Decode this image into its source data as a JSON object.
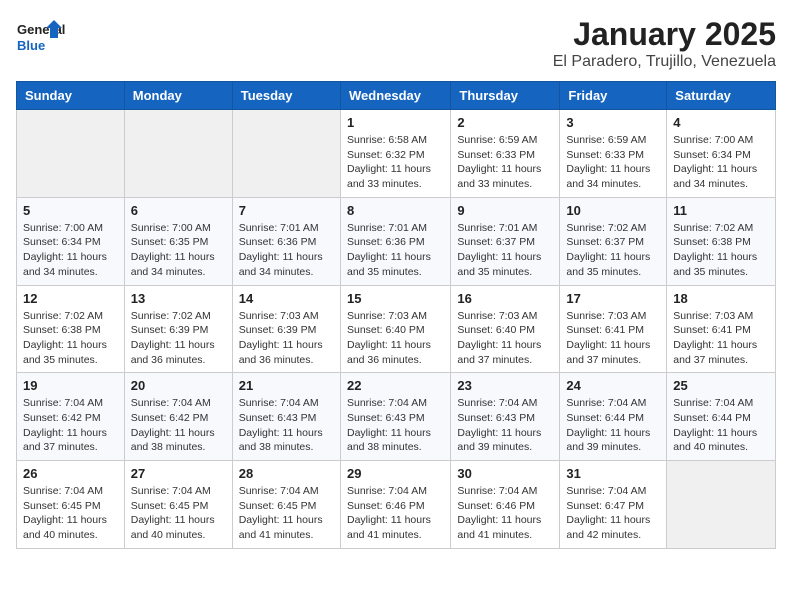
{
  "logo": {
    "line1": "General",
    "line2": "Blue"
  },
  "title": "January 2025",
  "subtitle": "El Paradero, Trujillo, Venezuela",
  "weekdays": [
    "Sunday",
    "Monday",
    "Tuesday",
    "Wednesday",
    "Thursday",
    "Friday",
    "Saturday"
  ],
  "weeks": [
    [
      {
        "day": "",
        "info": ""
      },
      {
        "day": "",
        "info": ""
      },
      {
        "day": "",
        "info": ""
      },
      {
        "day": "1",
        "info": "Sunrise: 6:58 AM\nSunset: 6:32 PM\nDaylight: 11 hours\nand 33 minutes."
      },
      {
        "day": "2",
        "info": "Sunrise: 6:59 AM\nSunset: 6:33 PM\nDaylight: 11 hours\nand 33 minutes."
      },
      {
        "day": "3",
        "info": "Sunrise: 6:59 AM\nSunset: 6:33 PM\nDaylight: 11 hours\nand 34 minutes."
      },
      {
        "day": "4",
        "info": "Sunrise: 7:00 AM\nSunset: 6:34 PM\nDaylight: 11 hours\nand 34 minutes."
      }
    ],
    [
      {
        "day": "5",
        "info": "Sunrise: 7:00 AM\nSunset: 6:34 PM\nDaylight: 11 hours\nand 34 minutes."
      },
      {
        "day": "6",
        "info": "Sunrise: 7:00 AM\nSunset: 6:35 PM\nDaylight: 11 hours\nand 34 minutes."
      },
      {
        "day": "7",
        "info": "Sunrise: 7:01 AM\nSunset: 6:36 PM\nDaylight: 11 hours\nand 34 minutes."
      },
      {
        "day": "8",
        "info": "Sunrise: 7:01 AM\nSunset: 6:36 PM\nDaylight: 11 hours\nand 35 minutes."
      },
      {
        "day": "9",
        "info": "Sunrise: 7:01 AM\nSunset: 6:37 PM\nDaylight: 11 hours\nand 35 minutes."
      },
      {
        "day": "10",
        "info": "Sunrise: 7:02 AM\nSunset: 6:37 PM\nDaylight: 11 hours\nand 35 minutes."
      },
      {
        "day": "11",
        "info": "Sunrise: 7:02 AM\nSunset: 6:38 PM\nDaylight: 11 hours\nand 35 minutes."
      }
    ],
    [
      {
        "day": "12",
        "info": "Sunrise: 7:02 AM\nSunset: 6:38 PM\nDaylight: 11 hours\nand 35 minutes."
      },
      {
        "day": "13",
        "info": "Sunrise: 7:02 AM\nSunset: 6:39 PM\nDaylight: 11 hours\nand 36 minutes."
      },
      {
        "day": "14",
        "info": "Sunrise: 7:03 AM\nSunset: 6:39 PM\nDaylight: 11 hours\nand 36 minutes."
      },
      {
        "day": "15",
        "info": "Sunrise: 7:03 AM\nSunset: 6:40 PM\nDaylight: 11 hours\nand 36 minutes."
      },
      {
        "day": "16",
        "info": "Sunrise: 7:03 AM\nSunset: 6:40 PM\nDaylight: 11 hours\nand 37 minutes."
      },
      {
        "day": "17",
        "info": "Sunrise: 7:03 AM\nSunset: 6:41 PM\nDaylight: 11 hours\nand 37 minutes."
      },
      {
        "day": "18",
        "info": "Sunrise: 7:03 AM\nSunset: 6:41 PM\nDaylight: 11 hours\nand 37 minutes."
      }
    ],
    [
      {
        "day": "19",
        "info": "Sunrise: 7:04 AM\nSunset: 6:42 PM\nDaylight: 11 hours\nand 37 minutes."
      },
      {
        "day": "20",
        "info": "Sunrise: 7:04 AM\nSunset: 6:42 PM\nDaylight: 11 hours\nand 38 minutes."
      },
      {
        "day": "21",
        "info": "Sunrise: 7:04 AM\nSunset: 6:43 PM\nDaylight: 11 hours\nand 38 minutes."
      },
      {
        "day": "22",
        "info": "Sunrise: 7:04 AM\nSunset: 6:43 PM\nDaylight: 11 hours\nand 38 minutes."
      },
      {
        "day": "23",
        "info": "Sunrise: 7:04 AM\nSunset: 6:43 PM\nDaylight: 11 hours\nand 39 minutes."
      },
      {
        "day": "24",
        "info": "Sunrise: 7:04 AM\nSunset: 6:44 PM\nDaylight: 11 hours\nand 39 minutes."
      },
      {
        "day": "25",
        "info": "Sunrise: 7:04 AM\nSunset: 6:44 PM\nDaylight: 11 hours\nand 40 minutes."
      }
    ],
    [
      {
        "day": "26",
        "info": "Sunrise: 7:04 AM\nSunset: 6:45 PM\nDaylight: 11 hours\nand 40 minutes."
      },
      {
        "day": "27",
        "info": "Sunrise: 7:04 AM\nSunset: 6:45 PM\nDaylight: 11 hours\nand 40 minutes."
      },
      {
        "day": "28",
        "info": "Sunrise: 7:04 AM\nSunset: 6:45 PM\nDaylight: 11 hours\nand 41 minutes."
      },
      {
        "day": "29",
        "info": "Sunrise: 7:04 AM\nSunset: 6:46 PM\nDaylight: 11 hours\nand 41 minutes."
      },
      {
        "day": "30",
        "info": "Sunrise: 7:04 AM\nSunset: 6:46 PM\nDaylight: 11 hours\nand 41 minutes."
      },
      {
        "day": "31",
        "info": "Sunrise: 7:04 AM\nSunset: 6:47 PM\nDaylight: 11 hours\nand 42 minutes."
      },
      {
        "day": "",
        "info": ""
      }
    ]
  ]
}
